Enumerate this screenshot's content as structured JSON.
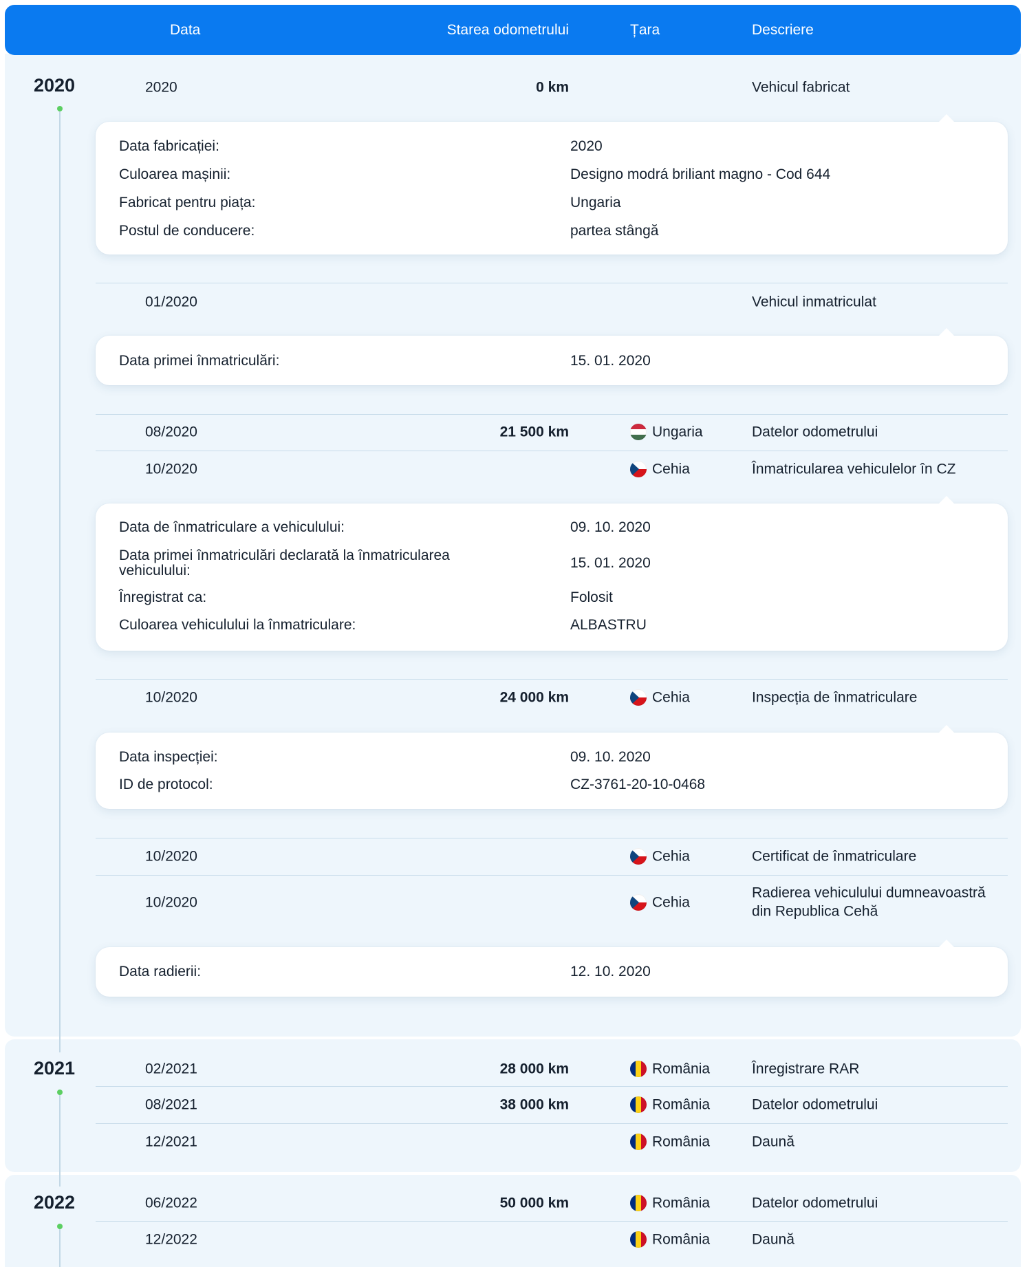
{
  "colors": {
    "header_bg": "#0a7af0",
    "header_text": "#ffffff",
    "year_block_bg": "#eef6fc",
    "timeline_dot": "#5ccf62",
    "timeline_line": "#c3d8e6",
    "text": "#15202e",
    "divider": "#c8dcea",
    "card_bg": "#ffffff"
  },
  "header": {
    "date": "Data",
    "odometer": "Starea odometrului",
    "country": "Țara",
    "description": "Descriere"
  },
  "years": [
    {
      "year": "2020",
      "entries": [
        {
          "date": "2020",
          "odometer": "0 km",
          "description": "Vehicul fabricat",
          "details": [
            {
              "label": "Data fabricației:",
              "value": "2020"
            },
            {
              "label": "Culoarea mașinii:",
              "value": "Designo modrá briliant magno - Cod 644"
            },
            {
              "label": "Fabricat pentru piața:",
              "value": "Ungaria"
            },
            {
              "label": "Postul de conducere:",
              "value": "partea stângă"
            }
          ]
        },
        {
          "date": "01/2020",
          "description": "Vehicul inmatriculat",
          "details": [
            {
              "label": "Data primei înmatriculări:",
              "value": "15. 01. 2020"
            }
          ]
        },
        {
          "date": "08/2020",
          "odometer": "21 500 km",
          "country": "Ungaria",
          "flag": "flag-hungary-icon",
          "description": "Datelor odometrului"
        },
        {
          "date": "10/2020",
          "country": "Cehia",
          "flag": "flag-czechia-icon",
          "description": "Înmatricularea vehiculelor în CZ",
          "details": [
            {
              "label": "Data de înmatriculare a vehiculului:",
              "value": "09. 10. 2020"
            },
            {
              "label": "Data primei înmatriculări declarată la înmatricularea vehiculului:",
              "value": "15. 01. 2020"
            },
            {
              "label": "Înregistrat ca:",
              "value": "Folosit"
            },
            {
              "label": "Culoarea vehiculului la înmatriculare:",
              "value": "ALBASTRU"
            }
          ]
        },
        {
          "date": "10/2020",
          "odometer": "24 000 km",
          "country": "Cehia",
          "flag": "flag-czechia-icon",
          "description": "Inspecția de înmatriculare",
          "details": [
            {
              "label": "Data inspecției:",
              "value": "09. 10. 2020"
            },
            {
              "label": "ID de protocol:",
              "value": "CZ-3761-20-10-0468"
            }
          ]
        },
        {
          "date": "10/2020",
          "country": "Cehia",
          "flag": "flag-czechia-icon",
          "description": "Certificat de înmatriculare"
        },
        {
          "date": "10/2020",
          "country": "Cehia",
          "flag": "flag-czechia-icon",
          "description": "Radierea vehiculului dumneavoastră din Republica Cehă",
          "details": [
            {
              "label": "Data radierii:",
              "value": "12. 10. 2020"
            }
          ]
        }
      ]
    },
    {
      "year": "2021",
      "entries": [
        {
          "date": "02/2021",
          "odometer": "28 000 km",
          "country": "România",
          "flag": "flag-romania-icon",
          "description": "Înregistrare RAR"
        },
        {
          "date": "08/2021",
          "odometer": "38 000 km",
          "country": "România",
          "flag": "flag-romania-icon",
          "description": "Datelor odometrului"
        },
        {
          "date": "12/2021",
          "country": "România",
          "flag": "flag-romania-icon",
          "description": "Daună"
        }
      ]
    },
    {
      "year": "2022",
      "entries": [
        {
          "date": "06/2022",
          "odometer": "50 000 km",
          "country": "România",
          "flag": "flag-romania-icon",
          "description": "Datelor odometrului"
        },
        {
          "date": "12/2022",
          "country": "România",
          "flag": "flag-romania-icon",
          "description": "Daună"
        }
      ]
    }
  ]
}
